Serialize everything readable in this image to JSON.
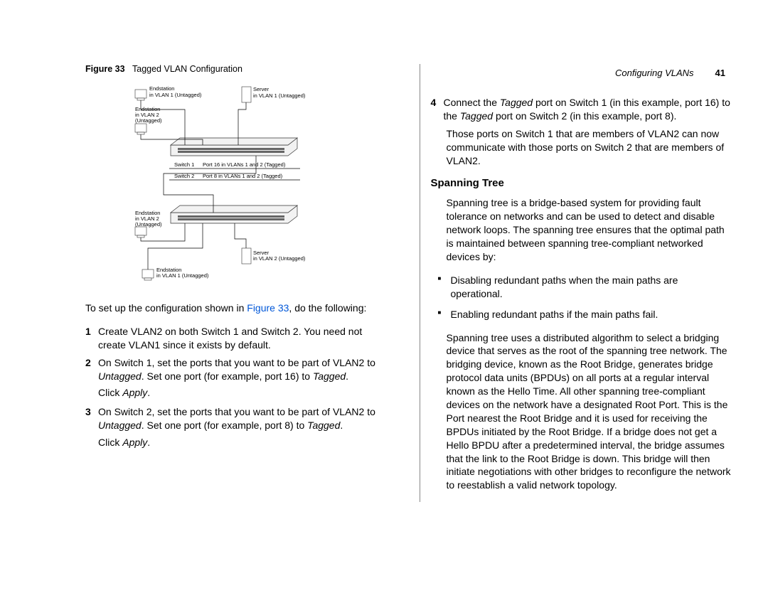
{
  "header": {
    "section": "Configuring VLANs",
    "page": "41"
  },
  "figure": {
    "label": "Figure 33",
    "caption": "Tagged VLAN Configuration",
    "labels": {
      "end_vlan1_u_top": "Endstation\nin VLAN 1  (Untagged)",
      "server_vlan1_u": "Server\nin VLAN 1 (Untagged)",
      "end_vlan2_u_a": "Endstation\nin VLAN 2\n(Untagged)",
      "switch1": "Switch 1",
      "switch2": "Switch 2",
      "port16": "Port 16 in VLANs 1 and 2 (Tagged)",
      "port8": "Port 8 in VLANs 1 and 2 (Tagged)",
      "end_vlan2_u_b": "Endstation\nin VLAN 2\n(Untagged)",
      "server_vlan2_u": "Server\nin VLAN 2  (Untagged)",
      "end_vlan1_u_bot": "Endstation\nin VLAN 1 (Untagged)"
    }
  },
  "left": {
    "intro_a": "To set up the configuration shown in ",
    "intro_link": "Figure 33",
    "intro_b": ", do the following:",
    "step1": "Create VLAN2 on both Switch 1 and Switch 2. You need not create VLAN1 since it exists by default.",
    "step2_a": "On Switch 1, set the ports that you want to be part of VLAN2 to ",
    "step2_i1": "Untagged",
    "step2_b": ". Set one port (for example, port 16) to ",
    "step2_i2": "Tagged",
    "step2_c": ".",
    "click": "Click ",
    "apply": "Apply",
    "step3_a": "On Switch 2, set the ports that you want to be part of VLAN2 to ",
    "step3_i1": "Untagged",
    "step3_b": ". Set one port (for example, port 8) to ",
    "step3_i2": "Tagged",
    "step3_c": "."
  },
  "right": {
    "step4_a": "Connect the ",
    "step4_i1": "Tagged",
    "step4_b": " port on Switch 1 (in this example, port 16) to the ",
    "step4_i2": "Tagged",
    "step4_c": " port on Switch 2 (in this example, port 8).",
    "para2": "Those ports on Switch 1 that are members of VLAN2 can now communicate with those ports on Switch 2 that are members of VLAN2.",
    "heading": "Spanning Tree",
    "st_intro": "Spanning tree is a bridge-based system for providing fault tolerance on networks and can be used to detect and disable network loops. The spanning tree ensures that the optimal path is maintained between spanning tree-compliant networked devices by:",
    "st_b1": "Disabling redundant paths when the main paths are operational.",
    "st_b2": "Enabling redundant paths if the main paths fail.",
    "st_long": "Spanning tree uses a distributed algorithm to select a bridging device that serves as the root of the spanning tree network. The bridging device, known as the Root Bridge, generates bridge protocol data units (BPDUs) on all ports at a regular interval known as the Hello Time. All other spanning tree-compliant devices on the network have a designated Root Port. This is the Port nearest the Root Bridge and it is used for receiving the BPDUs initiated by the Root Bridge. If a bridge does not get a Hello BPDU after a predetermined interval, the bridge assumes that the link to the Root Bridge is down. This bridge will then initiate negotiations with other bridges to reconfigure the network to reestablish a valid network topology."
  }
}
